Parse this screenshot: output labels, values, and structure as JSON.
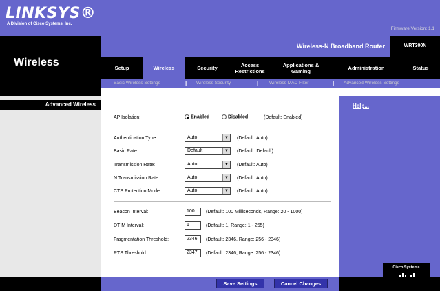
{
  "brand": {
    "logo": "LINKSYS®",
    "subtitle": "A Division of Cisco Systems, Inc.",
    "firmware": "Firmware Version: 1.1"
  },
  "product": {
    "name": "Wireless-N Broadband Router",
    "model": "WRT300N"
  },
  "section": "Wireless",
  "tabs": [
    {
      "label": "Setup"
    },
    {
      "label": "Wireless"
    },
    {
      "label": "Security"
    },
    {
      "label": "Access Restrictions"
    },
    {
      "label": "Applications & Gaming"
    },
    {
      "label": "Administration"
    },
    {
      "label": "Status"
    }
  ],
  "subtabs": [
    "Basic Wireless Settings",
    "Wireless Security",
    "Wireless MAC Filter",
    "Advanced Wireless Settings"
  ],
  "left_label": "Advanced Wireless",
  "form": {
    "ap_isolation": {
      "label": "AP Isolation:",
      "enabled": "Enabled",
      "disabled": "Disabled",
      "default": "(Default: Enabled)"
    },
    "auth_type": {
      "label": "Authentication Type:",
      "value": "Auto",
      "default": "(Default: Auto)"
    },
    "basic_rate": {
      "label": "Basic Rate:",
      "value": "Default",
      "default": "(Default: Default)"
    },
    "tx_rate": {
      "label": "Transmission Rate:",
      "value": "Auto",
      "default": "(Default: Auto)"
    },
    "n_tx_rate": {
      "label": "N Transmission Rate:",
      "value": "Auto",
      "default": "(Default: Auto)"
    },
    "cts_mode": {
      "label": "CTS Protection Mode:",
      "value": "Auto",
      "default": "(Default: Auto)"
    },
    "beacon": {
      "label": "Beacon Interval:",
      "value": "100",
      "default": "(Default: 100 Milliseconds, Range: 20 - 1000)"
    },
    "dtim": {
      "label": "DTIM Interval:",
      "value": "1",
      "default": "(Default: 1, Range: 1 - 255)"
    },
    "frag": {
      "label": "Fragmentation Threshold:",
      "value": "2346",
      "default": "(Default: 2346, Range: 256 - 2346)"
    },
    "rts": {
      "label": "RTS Threshold:",
      "value": "2347",
      "default": "(Default: 2346, Range: 256 - 2346)"
    }
  },
  "help": "Help...",
  "cisco": "Cisco Systems",
  "buttons": {
    "save": "Save Settings",
    "cancel": "Cancel Changes"
  }
}
